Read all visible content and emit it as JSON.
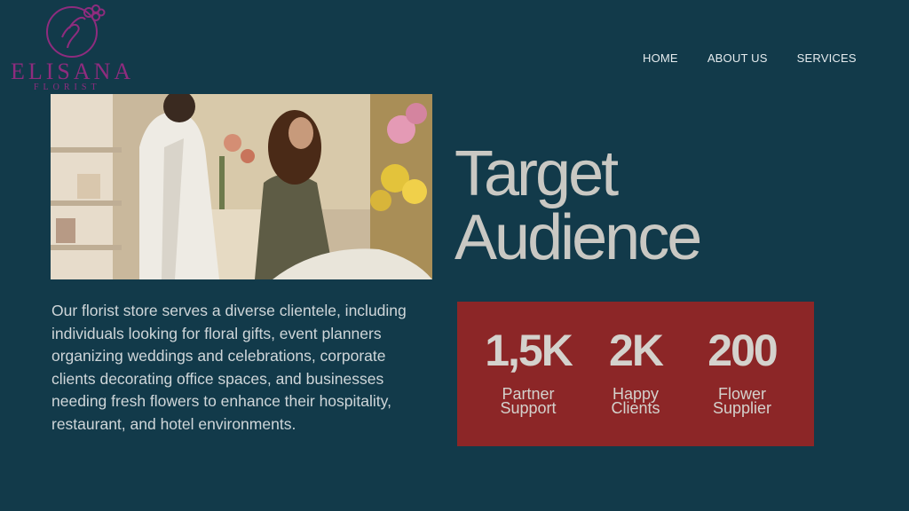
{
  "logo": {
    "name": "ELISANA",
    "subtitle": "FLORIST",
    "color": "#8e2c7e"
  },
  "nav": {
    "items": [
      {
        "label": "HOME"
      },
      {
        "label": "ABOUT US"
      },
      {
        "label": "SERVICES"
      }
    ]
  },
  "hero": {
    "title_line1": "Target",
    "title_line2": "Audience",
    "description": "Our florist store serves a diverse clientele, including individuals looking for floral gifts, event planners organizing weddings and celebrations, corporate clients decorating office spaces, and businesses needing fresh flowers to enhance their hospitality, restaurant, and hotel environments."
  },
  "stats": [
    {
      "value": "1,5K",
      "label_line1": "Partner",
      "label_line2": "Support"
    },
    {
      "value": "2K",
      "label_line1": "Happy",
      "label_line2": "Clients"
    },
    {
      "value": "200",
      "label_line1": "Flower",
      "label_line2": "Supplier"
    }
  ],
  "colors": {
    "background": "#123a4a",
    "stats_panel": "#8c2627",
    "title": "#c9c8c3"
  }
}
